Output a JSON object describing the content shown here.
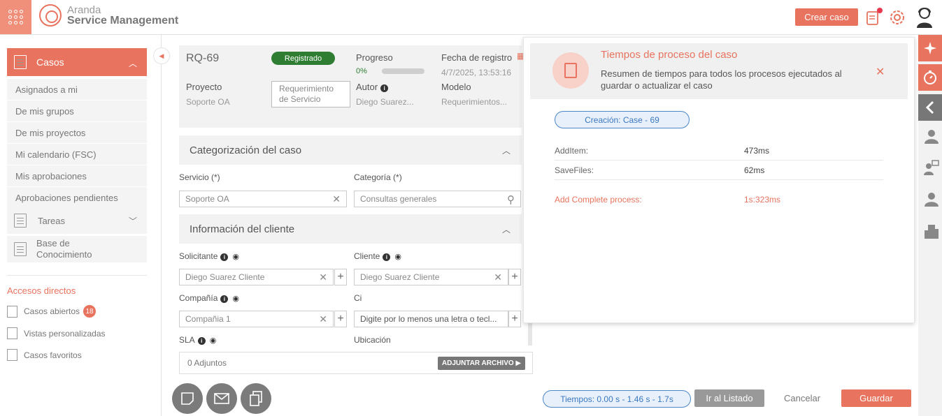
{
  "header": {
    "logo_line1": "Aranda",
    "logo_line2": "Service Management",
    "create_button": "Crear caso"
  },
  "sidebar": {
    "cases_label": "Casos",
    "sub_items": [
      "Asignados a mi",
      "De mis grupos",
      "De mis proyectos",
      "Mi calendario (FSC)",
      "Mis aprobaciones",
      "Aprobaciones pendientes"
    ],
    "tasks_label": "Tareas",
    "knowledge_label": "Base de Conocimiento",
    "shortcuts_title": "Accesos directos",
    "shortcuts": [
      {
        "label": "Casos abiertos",
        "count": "18"
      },
      {
        "label": "Vistas personalizadas"
      },
      {
        "label": "Casos favoritos"
      }
    ]
  },
  "case": {
    "id": "RQ-69",
    "status": "Registrado",
    "progress_label": "Progreso",
    "progress_value": "0%",
    "progress_fraction": 0,
    "date_label": "Fecha de registro",
    "date_value": "4/7/2025, 13:53:16",
    "project_label": "Proyecto",
    "project_value": "Soporte OA",
    "service_type": "Requerimiento de Servicio",
    "author_label": "Autor",
    "author_value": "Diego Suarez...",
    "model_label": "Modelo",
    "model_value": "Requerimientos..."
  },
  "categorization": {
    "title": "Categorización del caso",
    "service_label": "Servicio (*)",
    "service_value": "Soporte OA",
    "category_label": "Categoría (*)",
    "category_placeholder": "Consultas generales"
  },
  "client": {
    "title": "Información del cliente",
    "requester_label": "Solicitante",
    "requester_value": "Diego Suarez Cliente",
    "client_label": "Cliente",
    "client_value": "Diego Suarez Cliente",
    "company_label": "Compañía",
    "company_value": "Compañia 1",
    "ci_label": "Ci",
    "ci_placeholder": "Digite por lo menos una letra o tecl...",
    "sla_label": "SLA",
    "location_label": "Ubicación"
  },
  "attachments": {
    "count_label": "0 Adjuntos",
    "button": "ADJUNTAR ARCHIVO"
  },
  "footer": {
    "times": "Tiempos: 0.00 s - 1.46 s - 1.7s",
    "to_list": "Ir al Listado",
    "cancel": "Cancelar",
    "save": "Guardar"
  },
  "process_panel": {
    "title": "Tiempos de proceso del caso",
    "description": "Resumen de tiempos para todos los procesos ejecutados al guardar o actualizar el caso",
    "creation": "Creación: Case - 69",
    "rows": [
      {
        "label": "AddItem:",
        "value": "473ms"
      },
      {
        "label": "SaveFiles:",
        "value": "62ms"
      }
    ],
    "total_label": "Add Complete process:",
    "total_value": "1s:323ms"
  },
  "colors": {
    "accent": "#e8735e",
    "status_green": "#2e7d32",
    "pill_blue": "#3a77c0"
  }
}
